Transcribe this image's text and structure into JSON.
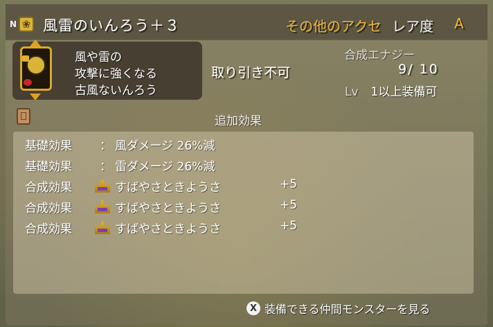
{
  "header": {
    "rank_badge": "N",
    "item_name": "風雷のいんろう＋３",
    "category": "その他のアクセ",
    "rarity_label": "レア度",
    "rarity_value": "A"
  },
  "item": {
    "description": [
      "風や雷の",
      "攻撃に強くなる",
      "古風ないんろう"
    ]
  },
  "stats": {
    "trade_status": "取り引き不可",
    "energy_label": "合成エナジー",
    "energy_value": "9/ 10",
    "level_prefix": "Lv",
    "level_requirement": "1以上装備可"
  },
  "effects": {
    "title": "追加効果",
    "separator": "：",
    "base": [
      {
        "type": "基礎効果",
        "desc": "風ダメージ 26%減"
      },
      {
        "type": "基礎効果",
        "desc": "雷ダメージ 26%減"
      }
    ],
    "synthesis": [
      {
        "type": "合成効果",
        "icon": "crown-icon",
        "stat": "すばやさときようさ",
        "amount": "+5"
      },
      {
        "type": "合成効果",
        "icon": "crown-icon",
        "stat": "すばやさときようさ",
        "amount": "+5"
      },
      {
        "type": "合成効果",
        "icon": "crown-icon",
        "stat": "すばやさときようさ",
        "amount": "+5"
      }
    ]
  },
  "footer": {
    "button_glyph": "X",
    "action_text": "装備できる仲間モンスターを見る"
  },
  "icons": {
    "header_icon": "ribbon-icon",
    "item_icon": "inro-icon",
    "book_icon": "book-icon"
  },
  "colors": {
    "accent": "#f0b43a",
    "text": "#ffffff"
  }
}
